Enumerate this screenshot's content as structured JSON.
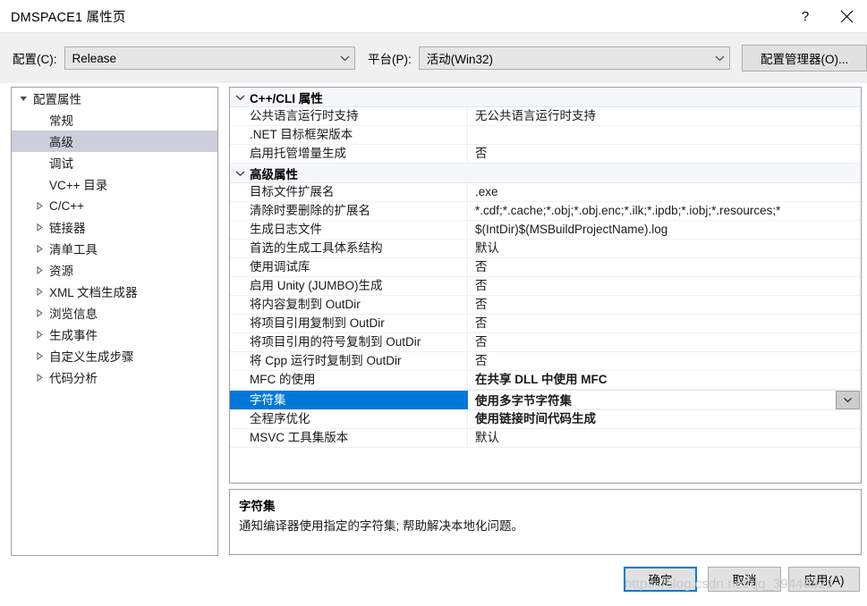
{
  "window": {
    "title": "DMSPACE1 属性页",
    "help_button": "?",
    "close_button": "✕"
  },
  "config_bar": {
    "configuration_label": "配置(C):",
    "configuration_value": "Release",
    "platform_label": "平台(P):",
    "platform_value": "活动(Win32)",
    "config_manager_button": "配置管理器(O)..."
  },
  "tree": {
    "items": [
      {
        "label": "配置属性",
        "level": 0,
        "twisty": "expanded",
        "selected": false
      },
      {
        "label": "常规",
        "level": 1,
        "twisty": "none",
        "selected": false
      },
      {
        "label": "高级",
        "level": 1,
        "twisty": "none",
        "selected": true
      },
      {
        "label": "调试",
        "level": 1,
        "twisty": "none",
        "selected": false
      },
      {
        "label": "VC++ 目录",
        "level": 1,
        "twisty": "none",
        "selected": false
      },
      {
        "label": "C/C++",
        "level": 1,
        "twisty": "collapsed",
        "selected": false
      },
      {
        "label": "链接器",
        "level": 1,
        "twisty": "collapsed",
        "selected": false
      },
      {
        "label": "清单工具",
        "level": 1,
        "twisty": "collapsed",
        "selected": false
      },
      {
        "label": "资源",
        "level": 1,
        "twisty": "collapsed",
        "selected": false
      },
      {
        "label": "XML 文档生成器",
        "level": 1,
        "twisty": "collapsed",
        "selected": false
      },
      {
        "label": "浏览信息",
        "level": 1,
        "twisty": "collapsed",
        "selected": false
      },
      {
        "label": "生成事件",
        "level": 1,
        "twisty": "collapsed",
        "selected": false
      },
      {
        "label": "自定义生成步骤",
        "level": 1,
        "twisty": "collapsed",
        "selected": false
      },
      {
        "label": "代码分析",
        "level": 1,
        "twisty": "collapsed",
        "selected": false
      }
    ]
  },
  "grid": {
    "rows": [
      {
        "kind": "category",
        "name": "C++/CLI 属性",
        "value": "",
        "expanded": true
      },
      {
        "kind": "property",
        "name": "公共语言运行时支持",
        "value": "无公共语言运行时支持",
        "bold": false,
        "selected": false
      },
      {
        "kind": "property",
        "name": ".NET 目标框架版本",
        "value": "",
        "bold": false,
        "selected": false
      },
      {
        "kind": "property",
        "name": "启用托管增量生成",
        "value": "否",
        "bold": false,
        "selected": false
      },
      {
        "kind": "category",
        "name": "高级属性",
        "value": "",
        "expanded": true
      },
      {
        "kind": "property",
        "name": "目标文件扩展名",
        "value": ".exe",
        "bold": false,
        "selected": false
      },
      {
        "kind": "property",
        "name": "清除时要删除的扩展名",
        "value": "*.cdf;*.cache;*.obj;*.obj.enc;*.ilk;*.ipdb;*.iobj;*.resources;*",
        "bold": false,
        "selected": false
      },
      {
        "kind": "property",
        "name": "生成日志文件",
        "value": "$(IntDir)$(MSBuildProjectName).log",
        "bold": false,
        "selected": false
      },
      {
        "kind": "property",
        "name": "首选的生成工具体系结构",
        "value": "默认",
        "bold": false,
        "selected": false
      },
      {
        "kind": "property",
        "name": "使用调试库",
        "value": "否",
        "bold": false,
        "selected": false
      },
      {
        "kind": "property",
        "name": "启用 Unity (JUMBO)生成",
        "value": "否",
        "bold": false,
        "selected": false
      },
      {
        "kind": "property",
        "name": "将内容复制到 OutDir",
        "value": "否",
        "bold": false,
        "selected": false
      },
      {
        "kind": "property",
        "name": "将项目引用复制到 OutDir",
        "value": "否",
        "bold": false,
        "selected": false
      },
      {
        "kind": "property",
        "name": "将项目引用的符号复制到 OutDir",
        "value": "否",
        "bold": false,
        "selected": false
      },
      {
        "kind": "property",
        "name": "将 Cpp 运行时复制到 OutDir",
        "value": "否",
        "bold": false,
        "selected": false
      },
      {
        "kind": "property",
        "name": "MFC 的使用",
        "value": "在共享 DLL 中使用 MFC",
        "bold": true,
        "selected": false
      },
      {
        "kind": "property",
        "name": "字符集",
        "value": "使用多字节字符集",
        "bold": true,
        "selected": true
      },
      {
        "kind": "property",
        "name": "全程序优化",
        "value": "使用链接时间代码生成",
        "bold": true,
        "selected": false
      },
      {
        "kind": "property",
        "name": "MSVC 工具集版本",
        "value": "默认",
        "bold": false,
        "selected": false
      }
    ]
  },
  "description": {
    "title": "字符集",
    "body": "通知编译器使用指定的字符集; 帮助解决本地化问题。"
  },
  "footer": {
    "ok_label": "确定",
    "cancel_label": "取消",
    "apply_label": "应用(A)"
  },
  "watermark": {
    "text": "https://blog.csdn.net/qq_39446329"
  },
  "colors": {
    "accent": "#0078d7",
    "tree_selection": "#cccedb",
    "category_bg": "#f5f7fa",
    "chrome_bg": "#f0f0f0"
  }
}
